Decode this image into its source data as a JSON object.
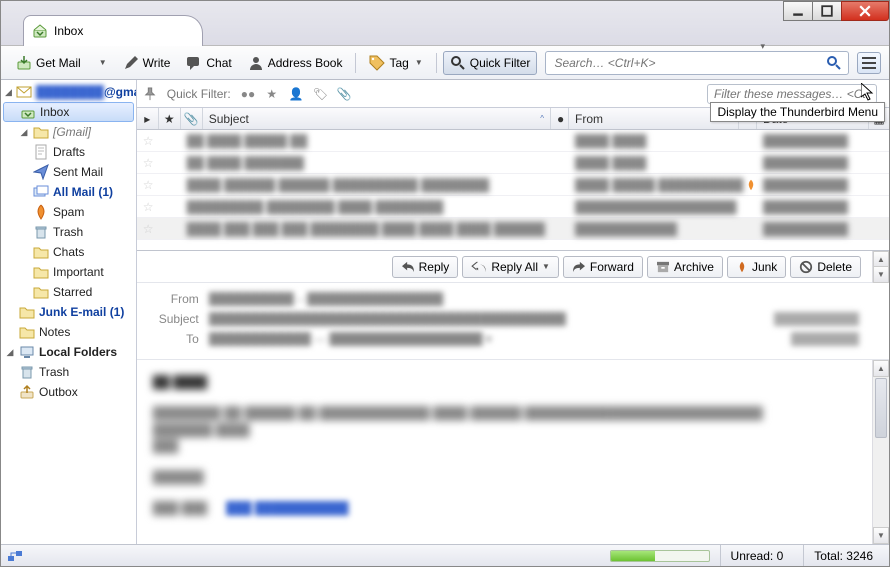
{
  "window": {
    "tooltip_menu": "Display the Thunderbird Menu"
  },
  "tab": {
    "title": "Inbox"
  },
  "toolbar": {
    "get_mail": "Get Mail",
    "write": "Write",
    "chat": "Chat",
    "address_book": "Address Book",
    "tag": "Tag",
    "quick_filter": "Quick Filter",
    "search_placeholder": "Search… <Ctrl+K>"
  },
  "tree": {
    "account": "████████@gmail.com",
    "items": [
      {
        "label": "Inbox"
      },
      {
        "label": "[Gmail]"
      },
      {
        "label": "Drafts"
      },
      {
        "label": "Sent Mail"
      },
      {
        "label": "All Mail (1)"
      },
      {
        "label": "Spam"
      },
      {
        "label": "Trash"
      },
      {
        "label": "Chats"
      },
      {
        "label": "Important"
      },
      {
        "label": "Starred"
      },
      {
        "label": "Junk E-mail (1)"
      },
      {
        "label": "Notes"
      }
    ],
    "local_header": "Local Folders",
    "local": [
      {
        "label": "Trash"
      },
      {
        "label": "Outbox"
      }
    ]
  },
  "quickfilter": {
    "label": "Quick Filter:",
    "placeholder": "Filter these messages… <Ctrl"
  },
  "columns": {
    "subject": "Subject",
    "from": "From",
    "date": "Date"
  },
  "rows": [
    {
      "s": "██ ████ █████ ██",
      "f": "████ ████",
      "d": "██████████"
    },
    {
      "s": "██ ████ ███████",
      "f": "████ ████",
      "d": "██████████"
    },
    {
      "s": "████ ██████ ██████ ██████████ ████████",
      "f": "████ █████ ██████████",
      "d": "██████████",
      "junk": true
    },
    {
      "s": "█████████ ████████ ████ ████████",
      "f": "███████████████████",
      "d": "██████████"
    },
    {
      "s": "████ ███ ███ ███ ████████ ████ ████ ████ ██████",
      "f": "████████████",
      "d": "██████████",
      "sel": true
    }
  ],
  "actions": {
    "reply": "Reply",
    "reply_all": "Reply All",
    "forward": "Forward",
    "archive": "Archive",
    "junk": "Junk",
    "delete": "Delete"
  },
  "preview": {
    "from_label": "From",
    "subject_label": "Subject",
    "to_label": "To"
  },
  "status": {
    "unread_label": "Unread:",
    "unread_value": "0",
    "total_label": "Total:",
    "total_value": "3246"
  }
}
